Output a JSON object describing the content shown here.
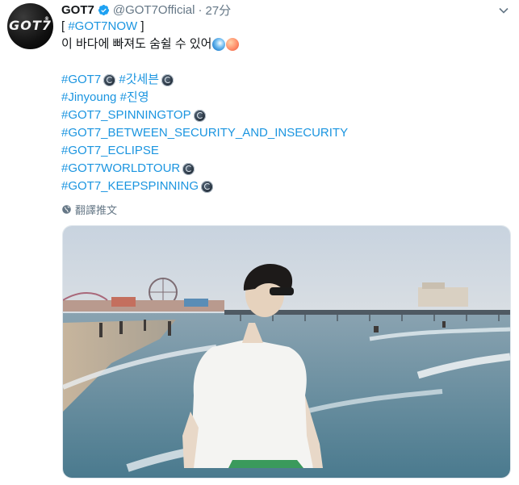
{
  "tweet": {
    "display_name": "GOT7",
    "handle": "@GOT7Official",
    "separator": "·",
    "time": "27分",
    "avatar_logo": "GOT7",
    "lines": [
      {
        "kind": "mixed",
        "parts": [
          {
            "t": "[ ",
            "c": "plain"
          },
          {
            "t": "#GOT7NOW",
            "c": "tag"
          },
          {
            "t": " ]",
            "c": "plain"
          }
        ]
      },
      {
        "kind": "mixed",
        "parts": [
          {
            "t": "이 바다에 빠져도 숨쉴 수 있어",
            "c": "plain"
          }
        ],
        "emojis": [
          "wave-emoji",
          "peach-emoji"
        ]
      },
      {
        "kind": "gap"
      },
      {
        "kind": "mixed",
        "parts": [
          {
            "t": "#GOT7",
            "c": "tag",
            "icon": true
          },
          {
            "t": " ",
            "c": "plain"
          },
          {
            "t": "#갓세븐",
            "c": "tag",
            "icon": true
          }
        ]
      },
      {
        "kind": "mixed",
        "parts": [
          {
            "t": "#Jinyoung",
            "c": "tag"
          },
          {
            "t": " ",
            "c": "plain"
          },
          {
            "t": "#진영",
            "c": "tag"
          }
        ]
      },
      {
        "kind": "mixed",
        "parts": [
          {
            "t": "#GOT7_SPINNINGTOP",
            "c": "tag",
            "icon": true
          }
        ]
      },
      {
        "kind": "mixed",
        "parts": [
          {
            "t": "#GOT7_BETWEEN_SECURITY_AND_INSECURITY",
            "c": "tag"
          }
        ]
      },
      {
        "kind": "mixed",
        "parts": [
          {
            "t": "#GOT7_ECLIPSE",
            "c": "tag"
          }
        ]
      },
      {
        "kind": "mixed",
        "parts": [
          {
            "t": "#GOT7WORLDTOUR",
            "c": "tag",
            "icon": true
          }
        ]
      },
      {
        "kind": "mixed",
        "parts": [
          {
            "t": "#GOT7_KEEPSPINNING",
            "c": "tag",
            "icon": true
          }
        ]
      }
    ],
    "translate_label": "翻譯推文"
  },
  "icons": {
    "verified": "verified-badge-icon",
    "caret": "chevron-down-icon",
    "globe": "globe-icon",
    "hashtag_emoji": "got7-hashflag-icon"
  },
  "colors": {
    "link": "#1b95e0",
    "text": "#14171a",
    "secondary": "#657786",
    "verified": "#1da1f2"
  }
}
